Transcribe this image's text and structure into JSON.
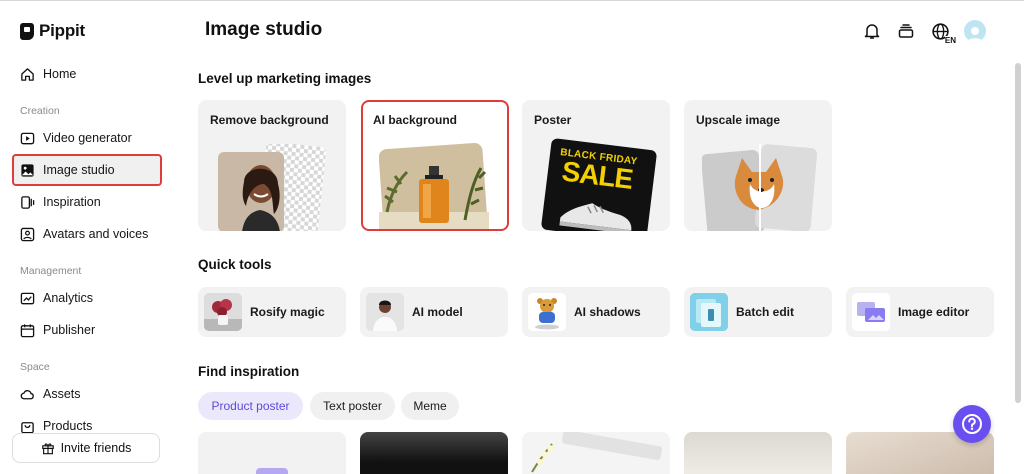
{
  "app": {
    "name": "Pippit"
  },
  "sidebar": {
    "items": [
      {
        "label": "Home",
        "icon": "home-icon"
      },
      {
        "label": "Video generator",
        "icon": "video-generator-icon"
      },
      {
        "label": "Image studio",
        "icon": "image-studio-icon",
        "active": true
      },
      {
        "label": "Inspiration",
        "icon": "inspiration-icon"
      },
      {
        "label": "Avatars and voices",
        "icon": "avatar-icon"
      },
      {
        "label": "Analytics",
        "icon": "analytics-icon"
      },
      {
        "label": "Publisher",
        "icon": "calendar-icon"
      },
      {
        "label": "Assets",
        "icon": "cloud-icon"
      },
      {
        "label": "Products",
        "icon": "bag-icon"
      }
    ],
    "sections": {
      "creation": "Creation",
      "management": "Management",
      "space": "Space"
    },
    "invite_label": "Invite friends"
  },
  "header": {
    "title": "Image studio",
    "lang_code": "EN",
    "icons": [
      "bell-icon",
      "stack-icon",
      "globe-icon",
      "avatar"
    ]
  },
  "main": {
    "level_up_title": "Level up marketing images",
    "features": [
      {
        "label": "Remove background"
      },
      {
        "label": "AI background",
        "active": true
      },
      {
        "label": "Poster",
        "poster_top": "BLACK FRIDAY",
        "poster_main": "SALE"
      },
      {
        "label": "Upscale image"
      }
    ],
    "quick_tools_title": "Quick tools",
    "tools": [
      {
        "label": "Rosify magic"
      },
      {
        "label": "AI model"
      },
      {
        "label": "AI shadows"
      },
      {
        "label": "Batch edit"
      },
      {
        "label": "Image editor"
      }
    ],
    "find_inspiration_title": "Find inspiration",
    "chips": [
      {
        "label": "Product poster",
        "selected": true
      },
      {
        "label": "Text poster"
      },
      {
        "label": "Meme"
      }
    ]
  },
  "colors": {
    "accent": "#6a4ff0",
    "highlight": "#e03c3c",
    "chip_selected_bg": "#ebe8fb"
  }
}
